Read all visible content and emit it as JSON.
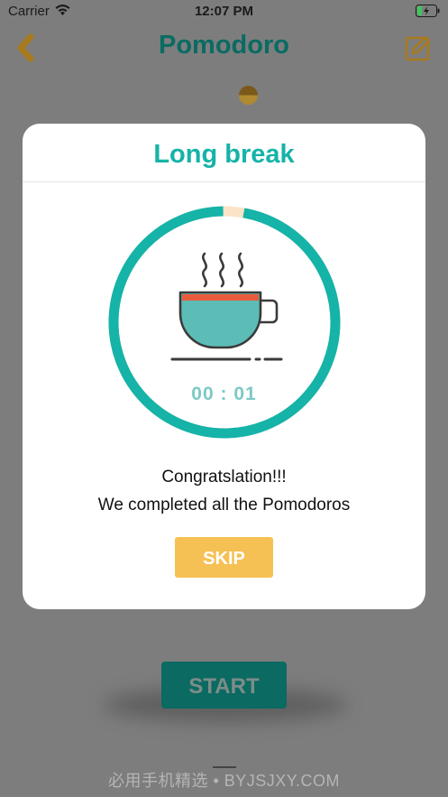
{
  "status_bar": {
    "carrier": "Carrier",
    "time": "12:07 PM"
  },
  "nav": {
    "title": "Pomodoro",
    "back_icon": "chevron-left-icon",
    "edit_icon": "edit-icon"
  },
  "background": {
    "start_label": "START"
  },
  "modal": {
    "title": "Long break",
    "timer": "00 : 01",
    "message_line1": "Congratslation!!!",
    "message_line2": "We completed all the Pomodoros",
    "skip_label": "SKIP",
    "progress_fraction": 0.97
  },
  "watermark": "必用手机精选 • BYJSJXY.COM",
  "colors": {
    "accent": "#15b3a8",
    "nav_title": "#0a6b63",
    "icon_gold": "#a87a1e",
    "skip_button": "#f5c155",
    "start_button": "#0b6a62",
    "cup_red": "#e85a3c"
  }
}
